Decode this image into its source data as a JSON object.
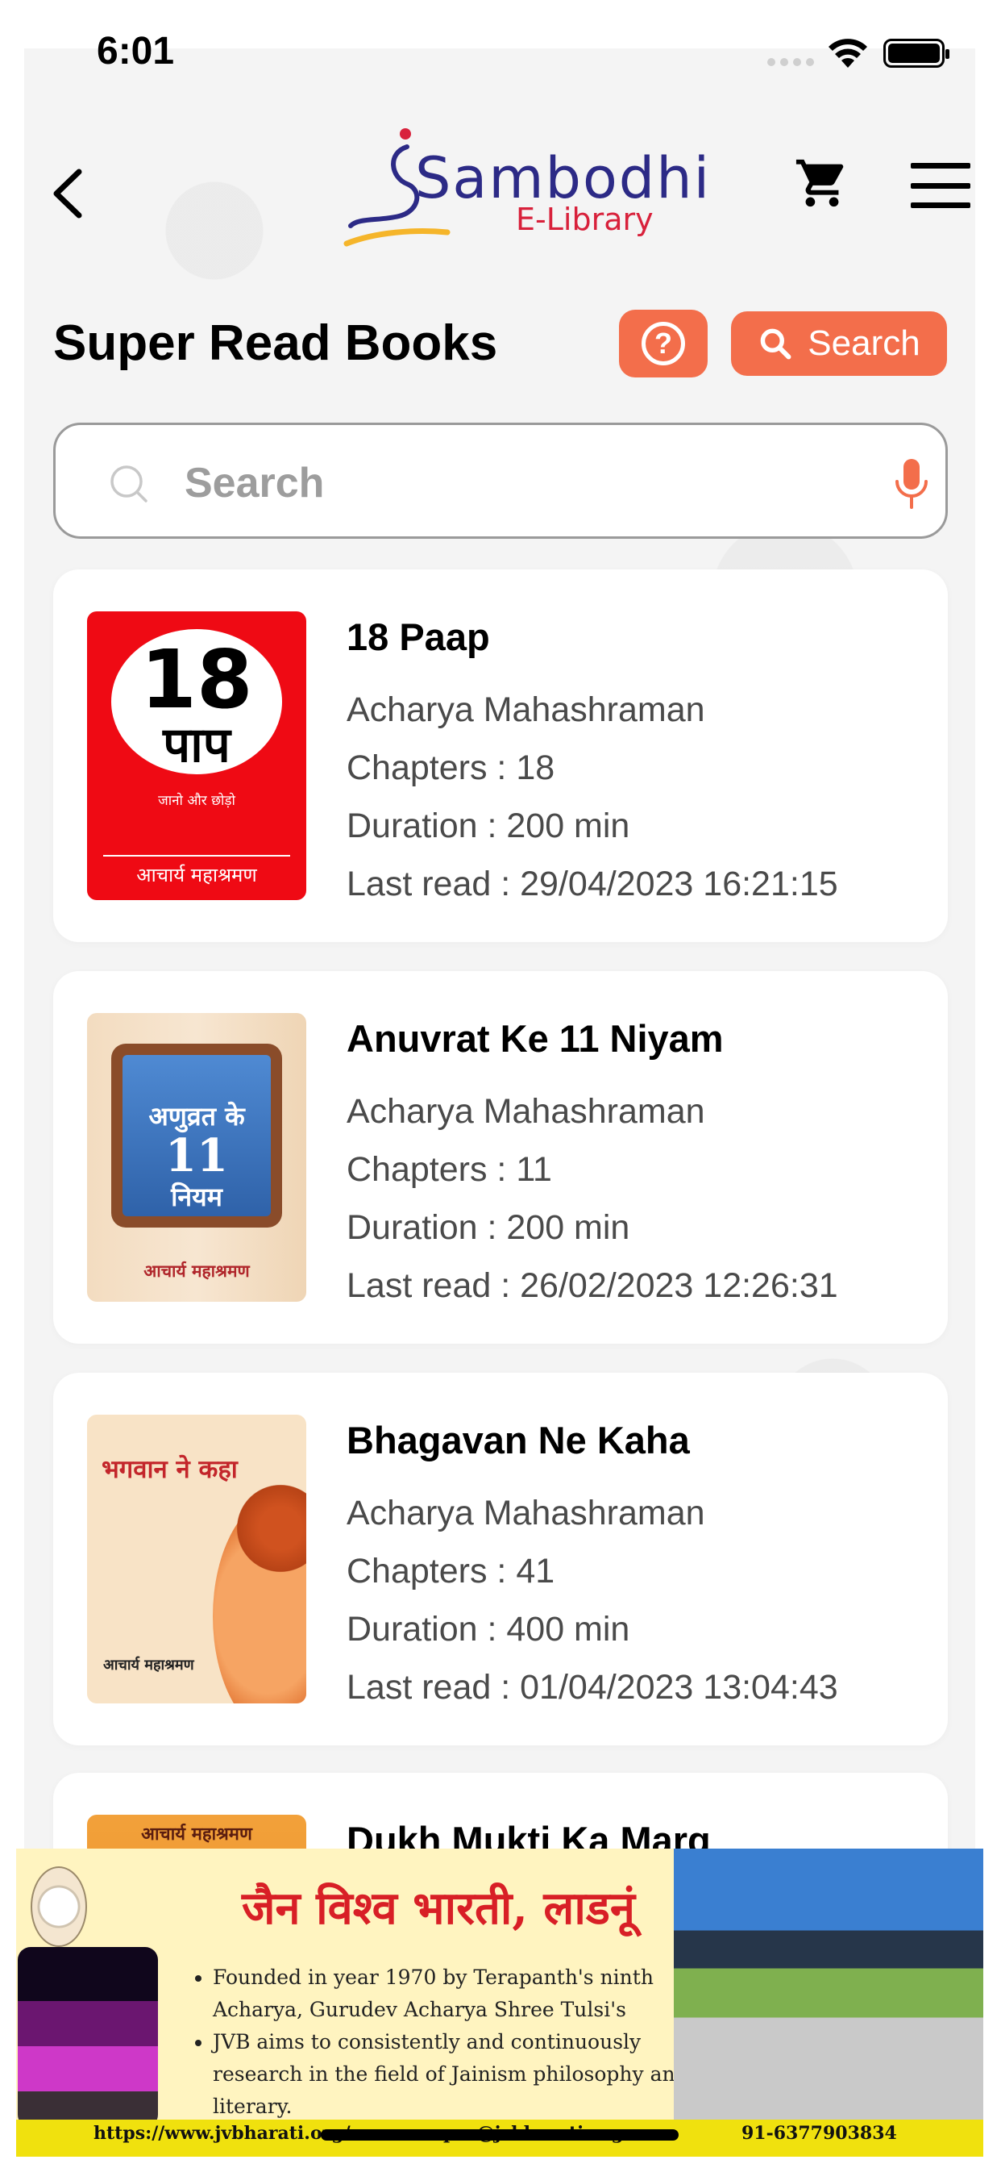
{
  "status_bar": {
    "time": "6:01"
  },
  "header": {
    "logo_text": "Sambodhi",
    "logo_subtitle": "E-Library"
  },
  "page": {
    "title": "Super Read Books",
    "help_label": "?",
    "search_button_label": "Search"
  },
  "search": {
    "placeholder": "Search",
    "value": ""
  },
  "books": [
    {
      "title": "18 Paap",
      "author": "Acharya Mahashraman",
      "chapters": "Chapters : 18",
      "duration": "Duration : 200 min",
      "last_read": "Last read : 29/04/2023 16:21:15",
      "cover": {
        "num": "18",
        "word": "पाप",
        "sub": "जानो और छोड़ो",
        "author": "आचार्य महाश्रमण"
      }
    },
    {
      "title": "Anuvrat Ke 11 Niyam",
      "author": "Acharya Mahashraman",
      "chapters": "Chapters : 11",
      "duration": "Duration : 200 min",
      "last_read": "Last read : 26/02/2023 12:26:31",
      "cover": {
        "t1": "अणुव्रत के",
        "t2": "11",
        "t3": "नियम",
        "author": "आचार्य महाश्रमण"
      }
    },
    {
      "title": "Bhagavan Ne Kaha",
      "author": "Acharya Mahashraman",
      "chapters": "Chapters : 41",
      "duration": "Duration : 400 min",
      "last_read": "Last read : 01/04/2023 13:04:43",
      "cover": {
        "t1": "भगवान ने कहा",
        "author": "आचार्य महाश्रमण"
      }
    },
    {
      "title": "Dukh Mukti Ka Marg",
      "cover": {
        "author": "आचार्य महाश्रमण"
      }
    }
  ],
  "banner": {
    "title": "जैन विश्व भारती, लाडनूं",
    "bullets": [
      "Founded in year 1970 by Terapanth's ninth Acharya, Gurudev Acharya Shree Tulsi's",
      "JVB aims to consistently and continuously research in the field of Jainism philosophy and literary."
    ],
    "url": "https://www.jvbharati.org/",
    "email": "pro@jvbharati.org",
    "phone": "91-6377903834"
  },
  "colors": {
    "accent": "#f36e4b",
    "logo_blue": "#2c2a86",
    "logo_red": "#d8213b"
  }
}
